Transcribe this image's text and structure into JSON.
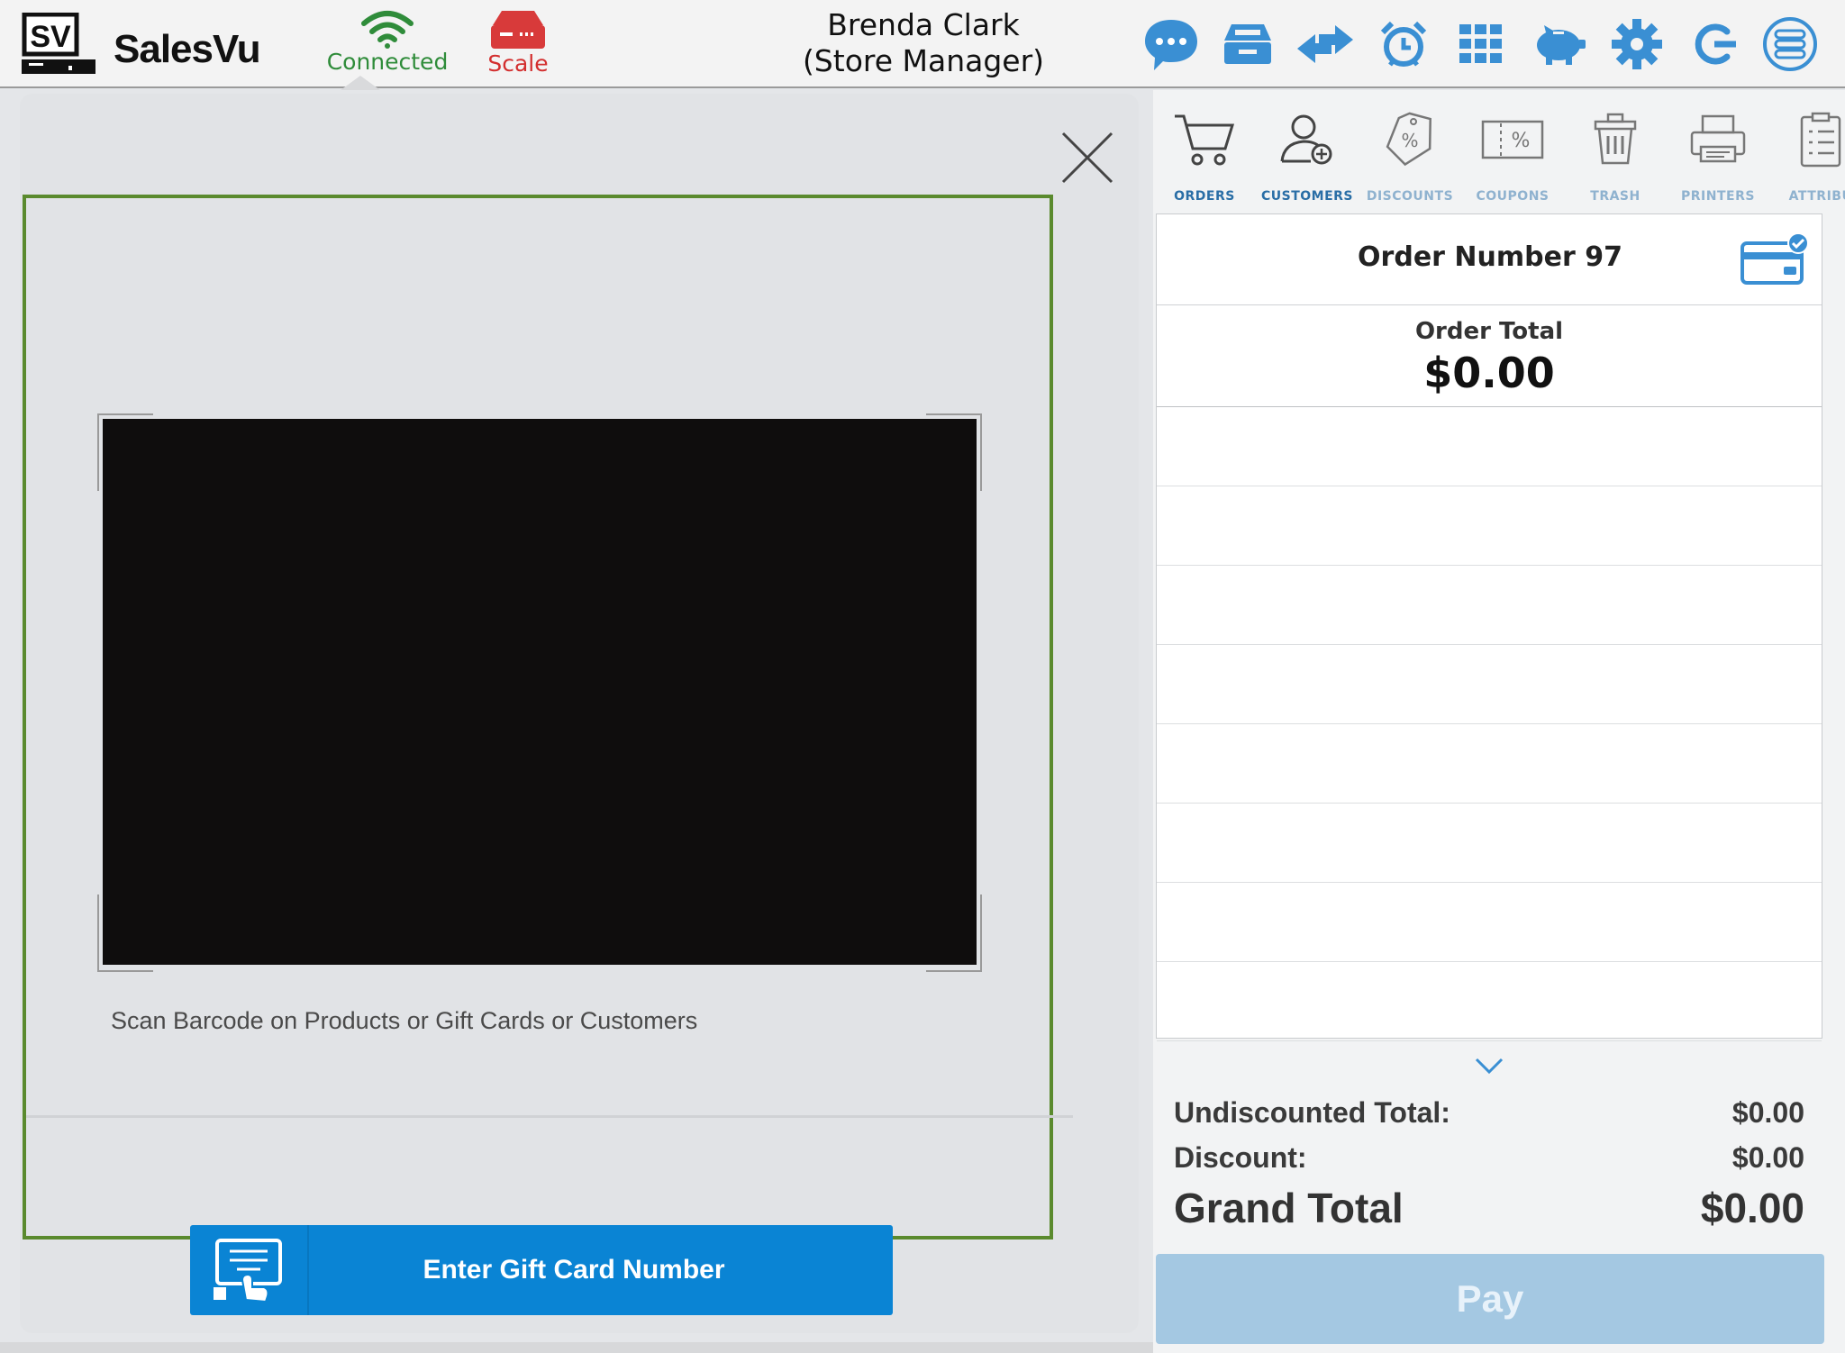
{
  "app": {
    "name": "SalesVu",
    "logo_text": "SV"
  },
  "status": {
    "connected_label": "Connected",
    "scale_label": "Scale"
  },
  "user": {
    "name": "Brenda Clark",
    "role": "(Store Manager)"
  },
  "top_icons": [
    "chat-icon",
    "cash-drawer-icon",
    "transfer-icon",
    "alarm-clock-icon",
    "grid-icon",
    "piggy-bank-icon",
    "settings-gear-icon",
    "logout-icon",
    "menu-list-icon"
  ],
  "colors": {
    "accent_blue": "#3a8fd3",
    "connected_green": "#2f8c3a",
    "scale_red": "#d32f2f",
    "scan_frame_green": "#5a8a2e",
    "button_blue": "#0a84d4",
    "pay_disabled": "#a4c8e2"
  },
  "scanner": {
    "hint": "Scan Barcode on Products or Gift Cards or Customers",
    "gift_button_label": "Enter Gift Card Number"
  },
  "tabs": [
    {
      "id": "orders",
      "label": "ORDERS",
      "icon": "cart-icon",
      "active": true
    },
    {
      "id": "customers",
      "label": "CUSTOMERS",
      "icon": "add-customer-icon",
      "active": true
    },
    {
      "id": "discounts",
      "label": "DISCOUNTS",
      "icon": "discount-tag-icon",
      "active": false
    },
    {
      "id": "coupons",
      "label": "COUPONS",
      "icon": "coupon-icon",
      "active": false
    },
    {
      "id": "trash",
      "label": "TRASH",
      "icon": "trash-icon",
      "active": false
    },
    {
      "id": "printers",
      "label": "PRINTERS",
      "icon": "printer-icon",
      "active": false
    },
    {
      "id": "attributes",
      "label": "ATTRIBU",
      "icon": "attributes-icon",
      "active": false
    }
  ],
  "order": {
    "number_label": "Order Number 97",
    "total_label": "Order Total",
    "total_value": "$0.00"
  },
  "totals": {
    "undiscounted_label": "Undiscounted Total:",
    "undiscounted_value": "$0.00",
    "discount_label": "Discount:",
    "discount_value": "$0.00",
    "grand_label": "Grand Total",
    "grand_value": "$0.00"
  },
  "pay_label": "Pay"
}
